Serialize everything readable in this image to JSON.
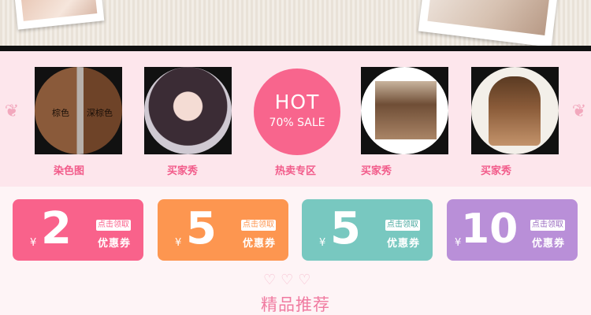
{
  "categories": [
    {
      "caption": "染色图",
      "photo_labels": [
        "棕色",
        "深棕色"
      ]
    },
    {
      "caption": "买家秀"
    },
    {
      "caption": "热卖专区",
      "badge_big": "HOT",
      "badge_small": "70% SALE"
    },
    {
      "caption": "买家秀"
    },
    {
      "caption": "买家秀"
    }
  ],
  "coupons": [
    {
      "currency": "¥",
      "amount": "2",
      "tag": "点击领取",
      "label": "优惠券",
      "color": "#f9628b"
    },
    {
      "currency": "¥",
      "amount": "5",
      "tag": "点击领取",
      "label": "优惠券",
      "color": "#fd9650"
    },
    {
      "currency": "¥",
      "amount": "5",
      "tag": "点击领取",
      "label": "优惠券",
      "color": "#78c8c0"
    },
    {
      "currency": "¥",
      "amount": "10",
      "tag": "点击领取",
      "label": "优惠券",
      "color": "#b98fd8"
    }
  ],
  "section_title": "精品推荐",
  "colors": {
    "accent_pink": "#f25b8a",
    "hot_badge": "#f8658d",
    "band_bg": "#fde6ec"
  }
}
